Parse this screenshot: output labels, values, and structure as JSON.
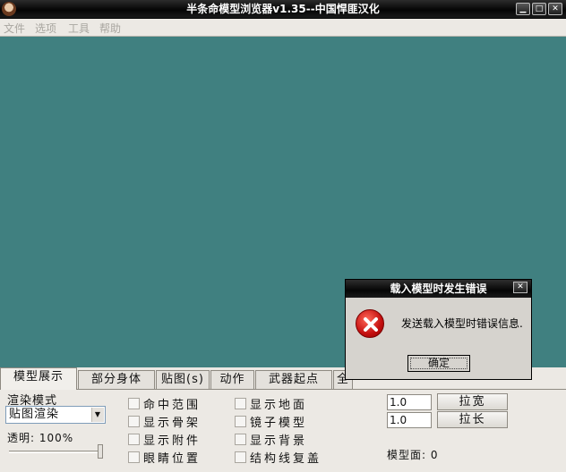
{
  "window": {
    "title": "半条命模型浏览器v1.35--中国悍匪汉化"
  },
  "menu": [
    "文件",
    "选项",
    "工具",
    "帮助"
  ],
  "tabs": [
    {
      "label": "模型展示",
      "active": true
    },
    {
      "label": "部分身体"
    },
    {
      "label": "贴图(s)"
    },
    {
      "label": "动作"
    },
    {
      "label": "武器起点"
    },
    {
      "label": "全"
    }
  ],
  "panel": {
    "render_mode_label": "渲染模式",
    "render_mode_value": "贴图渲染",
    "opacity_label": "透明: 100%",
    "opacity_value": 1.0,
    "checkboxes_col1": [
      "命中范围",
      "显示骨架",
      "显示附件",
      "眼睛位置"
    ],
    "checkboxes_col2": [
      "显示地面",
      "镜子模型",
      "显示背景",
      "结构线复盖"
    ],
    "scale_width_value": "1.0",
    "scale_height_value": "1.0",
    "stretch_width_button": "拉宽",
    "stretch_height_button": "拉长",
    "model_faces_label": "模型面: 0"
  },
  "dialog": {
    "title": "载入模型时发生错误",
    "message": "发送载入模型时错误信息.",
    "ok_button": "确定",
    "icon": "error-icon"
  },
  "colors": {
    "viewport": "#408080",
    "titlebar": "#050505",
    "panel": "#ece9e4"
  }
}
